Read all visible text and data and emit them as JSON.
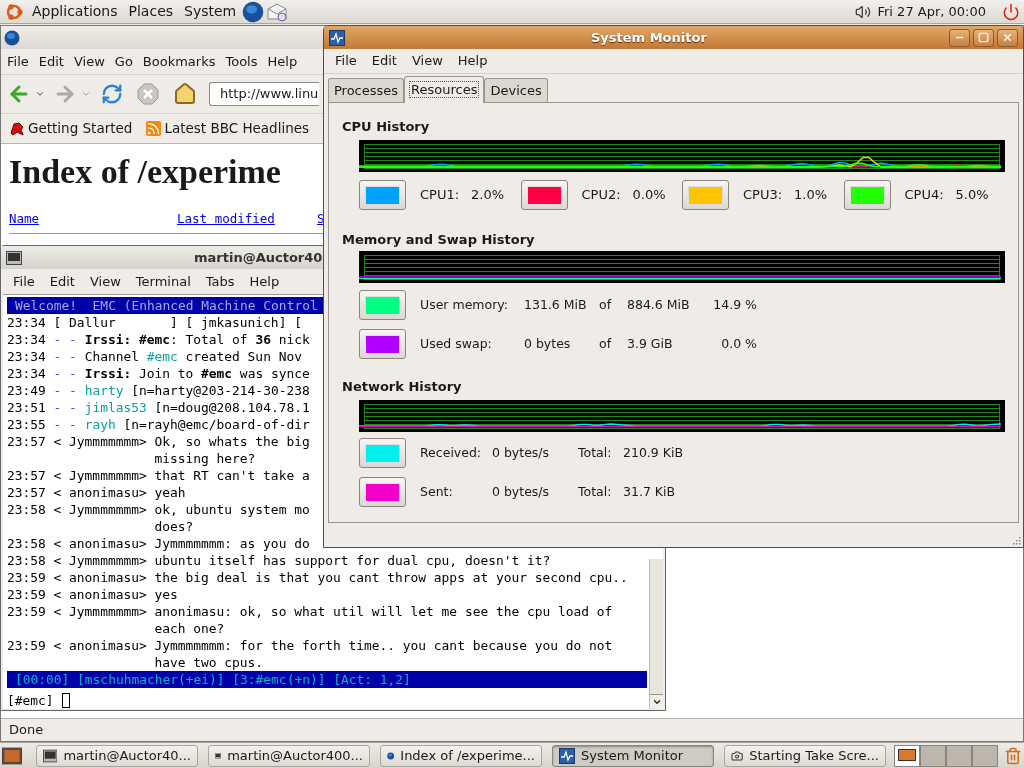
{
  "top_panel": {
    "menus": [
      "Applications",
      "Places",
      "System"
    ],
    "clock": "Fri 27 Apr, 00:00"
  },
  "browser": {
    "menus": [
      "File",
      "Edit",
      "View",
      "Go",
      "Bookmarks",
      "Tools",
      "Help"
    ],
    "url": "http://www.linu",
    "bookmarks": [
      "Getting Started",
      "Latest BBC Headlines"
    ],
    "heading": "Index of /experime",
    "columns": [
      "Name",
      "Last modified",
      "S"
    ],
    "status": "Done"
  },
  "terminal": {
    "title": "martin@Auctor40",
    "menus": [
      "File",
      "Edit",
      "View",
      "Terminal",
      "Tabs",
      "Help"
    ],
    "welcome": "Welcome!  EMC (Enhanced Machine Control",
    "lines": [
      {
        "kind": "line",
        "segments": [
          {
            "text": "23:34 [ Dallur       ] [ jmkasunich] [",
            "kind": "plain"
          }
        ]
      },
      {
        "kind": "line",
        "segments": [
          {
            "text": "23:34 ",
            "kind": "plain"
          },
          {
            "text": "- - ",
            "kind": "dim"
          },
          {
            "text": "Irssi: #emc",
            "kind": "bold"
          },
          {
            "text": ": Total of ",
            "kind": "plain"
          },
          {
            "text": "36",
            "kind": "bold"
          },
          {
            "text": " nick",
            "kind": "plain"
          }
        ]
      },
      {
        "kind": "line",
        "segments": [
          {
            "text": "23:34 ",
            "kind": "plain"
          },
          {
            "text": "- - ",
            "kind": "dim"
          },
          {
            "text": "Channel ",
            "kind": "plain"
          },
          {
            "text": "#emc",
            "kind": "cyan"
          },
          {
            "text": " created Sun Nov",
            "kind": "plain"
          }
        ]
      },
      {
        "kind": "line",
        "segments": [
          {
            "text": "23:34 ",
            "kind": "plain"
          },
          {
            "text": "- - ",
            "kind": "dim"
          },
          {
            "text": "Irssi:",
            "kind": "bold"
          },
          {
            "text": " Join to ",
            "kind": "plain"
          },
          {
            "text": "#emc",
            "kind": "bold"
          },
          {
            "text": " was synce",
            "kind": "plain"
          }
        ]
      },
      {
        "kind": "line",
        "segments": [
          {
            "text": "23:49 ",
            "kind": "plain"
          },
          {
            "text": "- - ",
            "kind": "dim"
          },
          {
            "text": "harty",
            "kind": "cyan"
          },
          {
            "text": " [n=harty@203-214-30-238",
            "kind": "plain"
          }
        ]
      },
      {
        "kind": "line",
        "segments": [
          {
            "text": "23:51 ",
            "kind": "plain"
          },
          {
            "text": "- - ",
            "kind": "dim"
          },
          {
            "text": "jimlas53",
            "kind": "cyan"
          },
          {
            "text": " [n=doug@208.104.78.1",
            "kind": "plain"
          }
        ]
      },
      {
        "kind": "line",
        "segments": [
          {
            "text": "23:55 ",
            "kind": "plain"
          },
          {
            "text": "- - ",
            "kind": "dim"
          },
          {
            "text": "rayh",
            "kind": "cyan"
          },
          {
            "text": " [n=rayh@emc/board-of-dir",
            "kind": "plain"
          }
        ]
      },
      {
        "kind": "line",
        "segments": [
          {
            "text": "23:57 < Jymmmmmmm> Ok, so whats the big",
            "kind": "plain"
          }
        ]
      },
      {
        "kind": "continuation",
        "segments": [
          {
            "text": "missing here?",
            "kind": "plain"
          }
        ]
      },
      {
        "kind": "line",
        "segments": [
          {
            "text": "23:57 < Jymmmmmmm> that RT can't take a",
            "kind": "plain"
          }
        ]
      },
      {
        "kind": "line",
        "segments": [
          {
            "text": "23:57 < anonimasu> yeah",
            "kind": "plain"
          }
        ]
      },
      {
        "kind": "line",
        "segments": [
          {
            "text": "23:58 < Jymmmmmmm> ok, ubuntu system mo",
            "kind": "plain"
          }
        ]
      },
      {
        "kind": "continuation",
        "segments": [
          {
            "text": "does?",
            "kind": "plain"
          }
        ]
      },
      {
        "kind": "line",
        "segments": [
          {
            "text": "23:58 < anonimasu> Jymmmmmmm: as you do",
            "kind": "plain"
          }
        ]
      },
      {
        "kind": "line",
        "segments": [
          {
            "text": "23:58 < Jymmmmmmm> ubuntu itself has support for dual cpu, doesn't it?",
            "kind": "plain"
          }
        ]
      },
      {
        "kind": "line",
        "segments": [
          {
            "text": "23:59 < anonimasu> the big deal is that you cant throw apps at your second cpu..",
            "kind": "plain"
          }
        ]
      },
      {
        "kind": "line",
        "segments": [
          {
            "text": "23:59 < anonimasu> yes",
            "kind": "plain"
          }
        ]
      },
      {
        "kind": "line",
        "segments": [
          {
            "text": "23:59 < Jymmmmmmm> anonimasu: ok, so what util will let me see the cpu load of",
            "kind": "plain"
          }
        ]
      },
      {
        "kind": "continuation",
        "segments": [
          {
            "text": "each one?",
            "kind": "plain"
          }
        ]
      },
      {
        "kind": "line",
        "segments": [
          {
            "text": "23:59 < anonimasu> Jymmmmmmm: for the forth time.. you cant because you do not",
            "kind": "plain"
          }
        ]
      },
      {
        "kind": "continuation",
        "segments": [
          {
            "text": "have two cpus.",
            "kind": "plain"
          }
        ]
      }
    ],
    "status_line": "[00:00] [mschuhmacher(+ei)] [3:#emc(+n)] [Act: 1,2]",
    "prompt": "[#emc]"
  },
  "system_monitor": {
    "title": "System Monitor",
    "menus": [
      "File",
      "Edit",
      "View",
      "Help"
    ],
    "tabs": [
      {
        "label": "Processes",
        "selected": false
      },
      {
        "label": "Resources",
        "selected": true
      },
      {
        "label": "Devices",
        "selected": false
      }
    ],
    "cpu": {
      "heading": "CPU History",
      "items": [
        {
          "label": "CPU1:",
          "value": "2.0%",
          "color": "#00a2ff"
        },
        {
          "label": "CPU2:",
          "value": "0.0%",
          "color": "#ff0044"
        },
        {
          "label": "CPU3:",
          "value": "1.0%",
          "color": "#ffc400"
        },
        {
          "label": "CPU4:",
          "value": "5.0%",
          "color": "#22ff00"
        }
      ]
    },
    "memory": {
      "heading": "Memory and Swap History",
      "items": [
        {
          "label": "User memory:",
          "used": "131.6 MiB",
          "of": "of",
          "total": "884.6 MiB",
          "percent": "14.9 %",
          "color": "#00ff80"
        },
        {
          "label": "Used swap:",
          "used": "0 bytes",
          "of": "of",
          "total": "3.9 GiB",
          "percent": "0.0 %",
          "color": "#b000ff"
        }
      ]
    },
    "network": {
      "heading": "Network History",
      "items": [
        {
          "label": "Received:",
          "rate": "0 bytes/s",
          "total_label": "Total:",
          "total": "210.9 KiB",
          "color": "#00f0f0"
        },
        {
          "label": "Sent:",
          "rate": "0 bytes/s",
          "total_label": "Total:",
          "total": "31.7 KiB",
          "color": "#f000c8"
        }
      ]
    }
  },
  "taskbar": {
    "tasks": [
      {
        "label": "martin@Auctor40...",
        "kind": "terminal",
        "selected": false
      },
      {
        "label": "martin@Auctor400...",
        "kind": "terminal",
        "selected": false
      },
      {
        "label": "Index of /experime...",
        "kind": "browser",
        "selected": false
      },
      {
        "label": "System Monitor",
        "kind": "monitor",
        "selected": true
      },
      {
        "label": "Starting Take Scre...",
        "kind": "camera",
        "selected": false
      }
    ],
    "workspaces": [
      {
        "selected": true
      },
      {
        "selected": false
      },
      {
        "selected": false
      },
      {
        "selected": false
      }
    ]
  }
}
